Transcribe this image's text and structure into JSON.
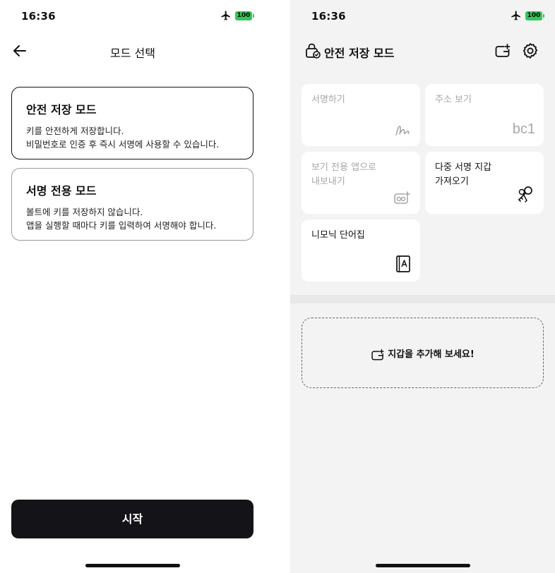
{
  "status_bar": {
    "time": "16:36",
    "battery": "100"
  },
  "left": {
    "nav_title": "모드 선택",
    "modes": [
      {
        "title": "안전 저장 모드",
        "desc_line1": "키를 안전하게 저장합니다.",
        "desc_line2": "비밀번호로 인증 후 즉시 서명에 사용할 수 있습니다.",
        "selected": true
      },
      {
        "title": "서명 전용 모드",
        "desc_line1": "볼트에 키를 저장하지 않습니다.",
        "desc_line2": "앱을 실행할 때마다 키를 입력하여 서명해야 합니다.",
        "selected": false
      }
    ],
    "start_label": "시작"
  },
  "right": {
    "header_title": "안전 저장 모드",
    "tiles": {
      "sign": {
        "label": "서명하기",
        "enabled": false,
        "icon": "signature-icon"
      },
      "address": {
        "label": "주소 보기",
        "enabled": false,
        "icon_text": "bc1"
      },
      "export": {
        "label_line1": "보기 전용 앱으로",
        "label_line2": "내보내기",
        "enabled": false,
        "icon": "export-app-icon"
      },
      "multisig": {
        "label_line1": "다중 서명 지갑",
        "label_line2": "가져오기",
        "enabled": true,
        "icon": "keys-icon"
      },
      "mnemonic": {
        "label": "니모닉 단어집",
        "enabled": true,
        "icon": "wordbook-icon"
      }
    },
    "add_wallet_label": "지갑을 추가해 보세요!"
  },
  "colors": {
    "battery": "#34c759",
    "button_dark": "#141418",
    "disabled_text": "#a7a7a7",
    "right_bg": "#f3f3f3"
  }
}
